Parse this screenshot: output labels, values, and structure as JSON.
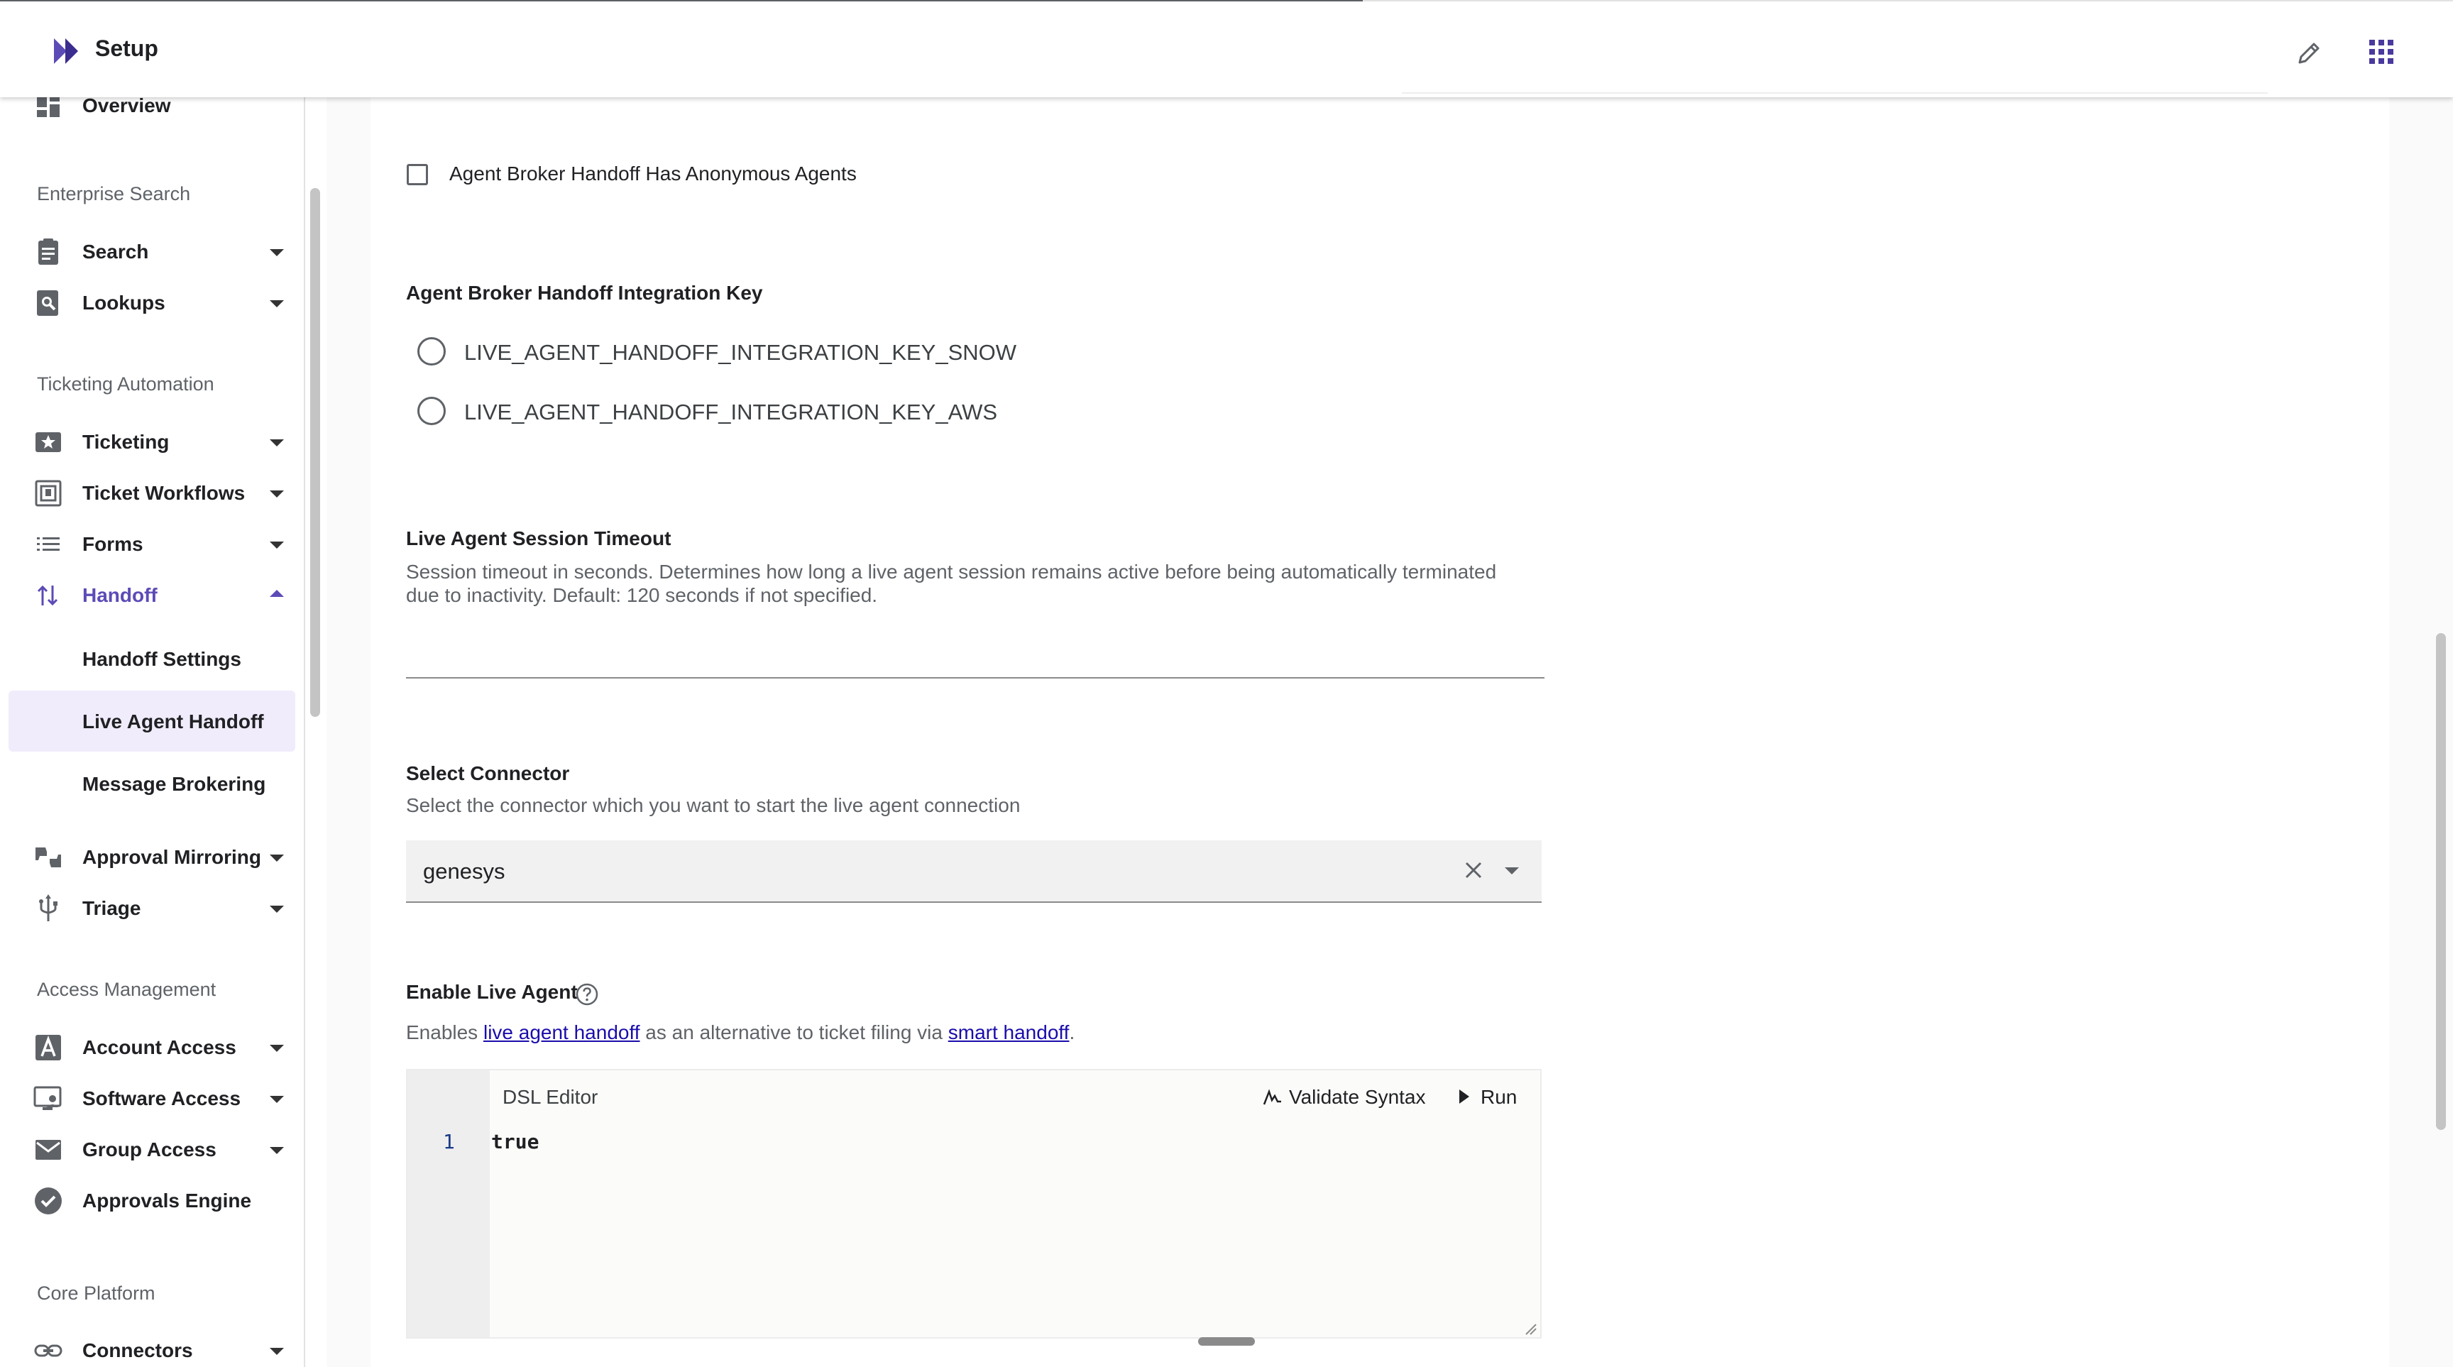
{
  "header": {
    "title": "Setup",
    "brand_icon": "double-chevron-logo",
    "edit_icon": "pencil-icon",
    "apps_icon": "apps-grid-icon",
    "accent": "#5b4bb7"
  },
  "sidebar": {
    "top_item": "Overview",
    "sections": {
      "enterprise_search": "Enterprise Search",
      "ticketing_automation": "Ticketing Automation",
      "access_management": "Access Management",
      "core_platform": "Core Platform"
    },
    "items": {
      "search": "Search",
      "lookups": "Lookups",
      "ticketing": "Ticketing",
      "ticket_workflows": "Ticket Workflows",
      "forms": "Forms",
      "handoff": "Handoff",
      "handoff_settings": "Handoff Settings",
      "live_agent_handoff": "Live Agent Handoff",
      "message_brokering": "Message Brokering",
      "approval_mirroring": "Approval Mirroring",
      "triage": "Triage",
      "account_access": "Account Access",
      "software_access": "Software Access",
      "group_access": "Group Access",
      "approvals_engine": "Approvals Engine",
      "connectors": "Connectors"
    }
  },
  "form": {
    "anonymous_agents_label": "Agent Broker Handoff Has Anonymous Agents",
    "anonymous_agents_checked": false,
    "integration_key": {
      "title": "Agent Broker Handoff Integration Key",
      "options": [
        "LIVE_AGENT_HANDOFF_INTEGRATION_KEY_SNOW",
        "LIVE_AGENT_HANDOFF_INTEGRATION_KEY_AWS"
      ]
    },
    "session_timeout": {
      "title": "Live Agent Session Timeout",
      "description_line1": "Session timeout in seconds. Determines how long a live agent session remains active before being automatically terminated",
      "description_line2": "due to inactivity. Default: 120 seconds if not specified.",
      "value": ""
    },
    "connector": {
      "title": "Select Connector",
      "description": "Select the connector which you want to start the live agent connection",
      "value": "genesys"
    },
    "enable_live_agent": {
      "title": "Enable Live Agent",
      "desc_prefix": "Enables ",
      "link1": "live agent handoff",
      "desc_middle": " as an alternative to ticket filing via ",
      "link2": "smart handoff",
      "desc_suffix": "."
    },
    "editor": {
      "title": "DSL Editor",
      "validate_label": "Validate Syntax",
      "run_label": "Run",
      "line_number": "1",
      "code": "true"
    }
  }
}
